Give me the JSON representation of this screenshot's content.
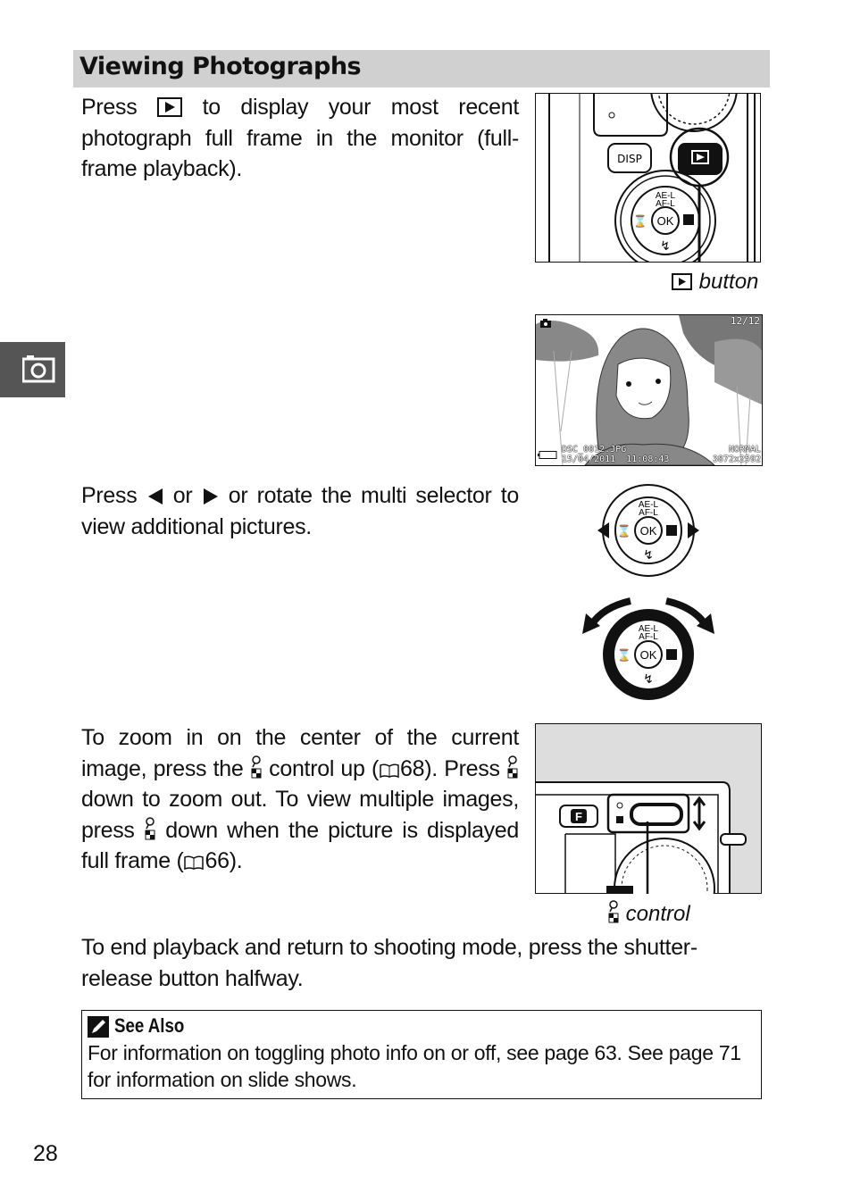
{
  "section": {
    "title": "Viewing Photographs"
  },
  "paragraphs": {
    "p1": {
      "before": "Press",
      "after": "to display your most recent photograph full frame in the monitor (full-frame playback)."
    },
    "p2": {
      "a": "Press",
      "b": "or",
      "c": "or rotate the multi selector to view additional pictures."
    },
    "p3": {
      "a": "To zoom in on the center of the current image, press the",
      "b": "control up (",
      "c": "68). Press",
      "d": "down to zoom out. To view multiple images, press",
      "e": "down when the picture is displayed full frame (",
      "f": "66)."
    },
    "p4": "To end playback and return to shooting mode, press the shutter-release button halfway."
  },
  "figures": {
    "playback_button": {
      "caption": "button",
      "disp_label": "DISP",
      "ok_label": "OK",
      "ael": "AE-L",
      "afl": "AF-L"
    },
    "monitor": {
      "frame_count": "12/12",
      "filename": "DSC_0012.JPG",
      "datetime": "15/04/2011  11:08:43",
      "quality": "NORMAL",
      "size": "3872x2592"
    },
    "zoom_control": {
      "caption": "control",
      "f_label": "F"
    }
  },
  "see_also": {
    "title": "See Also",
    "text": "For information on toggling photo info on or off, see page 63. See page 71 for information on slide shows."
  },
  "side_tab": {
    "icon": "playback-camera-icon"
  },
  "page_number": "28"
}
